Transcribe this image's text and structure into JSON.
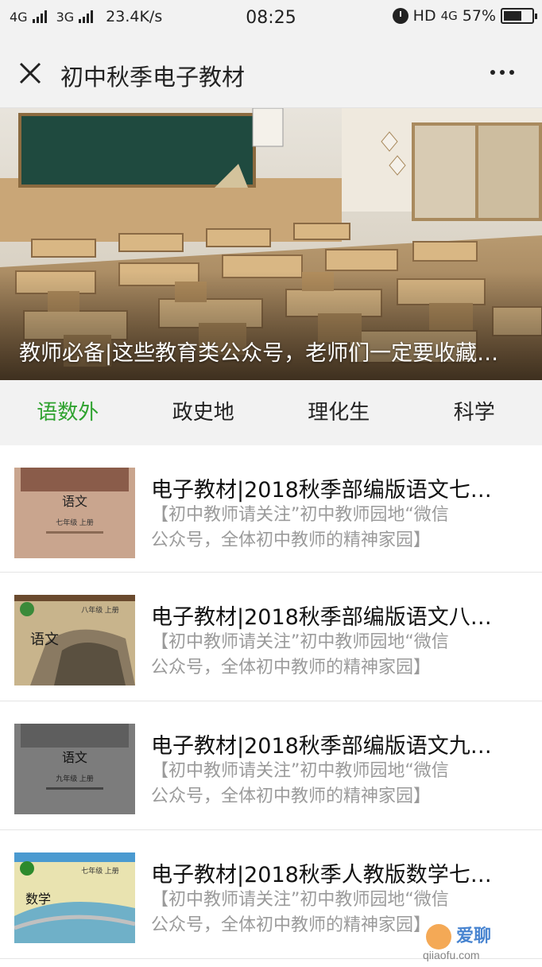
{
  "status_bar": {
    "network_1": "4G",
    "network_2": "3G",
    "speed": "23.4K/s",
    "time": "08:25",
    "hd": "HD",
    "net_right": "4G",
    "battery": "57%"
  },
  "nav": {
    "title": "初中秋季电子教材"
  },
  "banner": {
    "caption": "教师必备|这些教育类公众号，老师们一定要收藏…"
  },
  "tabs": [
    {
      "label": "语数外",
      "active": true
    },
    {
      "label": "政史地",
      "active": false
    },
    {
      "label": "理化生",
      "active": false
    },
    {
      "label": "科学",
      "active": false
    }
  ],
  "articles": [
    {
      "title": "电子教材|2018秋季部编版语文七…",
      "desc_line1": "【初中教师请关注”初中教师园地“微信",
      "desc_line2": "公众号，全体初中教师的精神家园】",
      "thumb_text": "语文",
      "thumb_grade": "七年级 上册"
    },
    {
      "title": "电子教材|2018秋季部编版语文八…",
      "desc_line1": "【初中教师请关注”初中教师园地“微信",
      "desc_line2": "公众号，全体初中教师的精神家园】",
      "thumb_text": "语文",
      "thumb_grade": "八年级 上册"
    },
    {
      "title": "电子教材|2018秋季部编版语文九…",
      "desc_line1": "【初中教师请关注”初中教师园地“微信",
      "desc_line2": "公众号，全体初中教师的精神家园】",
      "thumb_text": "语文",
      "thumb_grade": "九年级 上册"
    },
    {
      "title": "电子教材|2018秋季人教版数学七…",
      "desc_line1": "【初中教师请关注”初中教师园地“微信",
      "desc_line2": "公众号，全体初中教师的精神家园】",
      "thumb_text": "数学",
      "thumb_grade": "七年级 上册"
    }
  ],
  "watermark": {
    "text": "爱聊",
    "url": "qiiaofu.com"
  },
  "colors": {
    "accent": "#2fa22f",
    "chrome": "#f2f2f2",
    "desc": "#9b9b9b"
  }
}
